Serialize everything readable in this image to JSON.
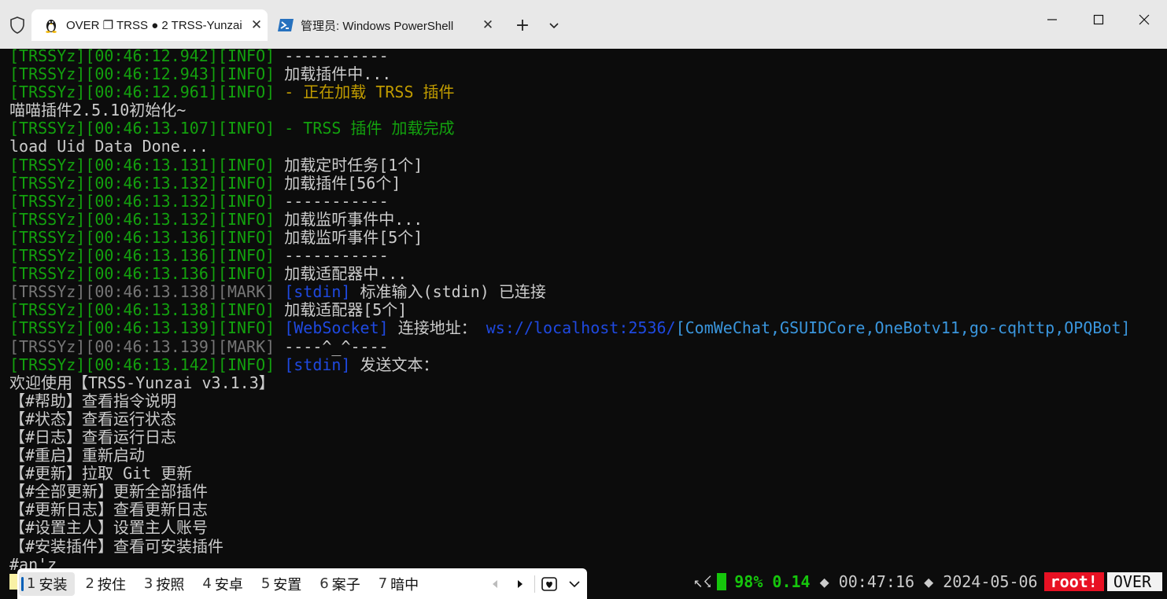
{
  "tabs": {
    "active_title": "OVER ❐ TRSS ● 2 TRSS-Yunzai",
    "inactive_title": "管理员: Windows PowerShell",
    "close_glyph": "✕",
    "new_tab_glyph": "+"
  },
  "terminal": {
    "lines": [
      [
        {
          "t": "[TRSSYz][00:46:12.942][INFO] ",
          "c": "green"
        },
        {
          "t": "-----------",
          "c": "white"
        }
      ],
      [
        {
          "t": "[TRSSYz][00:46:12.943][INFO] ",
          "c": "green"
        },
        {
          "t": "加载插件中...",
          "c": "white"
        }
      ],
      [
        {
          "t": "[TRSSYz][00:46:12.961][INFO] ",
          "c": "green"
        },
        {
          "t": "- 正在加载 TRSS 插件",
          "c": "gold"
        }
      ],
      [
        {
          "t": "喵喵插件2.5.10初始化~",
          "c": "white"
        }
      ],
      [
        {
          "t": "[TRSSYz][00:46:13.107][INFO] ",
          "c": "green"
        },
        {
          "t": "- TRSS 插件 加载完成",
          "c": "green"
        }
      ],
      [
        {
          "t": "load Uid Data Done...",
          "c": "white"
        }
      ],
      [
        {
          "t": "[TRSSYz][00:46:13.131][INFO] ",
          "c": "green"
        },
        {
          "t": "加载定时任务[1个]",
          "c": "white"
        }
      ],
      [
        {
          "t": "[TRSSYz][00:46:13.132][INFO] ",
          "c": "green"
        },
        {
          "t": "加载插件[56个]",
          "c": "white"
        }
      ],
      [
        {
          "t": "[TRSSYz][00:46:13.132][INFO] ",
          "c": "green"
        },
        {
          "t": "-----------",
          "c": "white"
        }
      ],
      [
        {
          "t": "[TRSSYz][00:46:13.132][INFO] ",
          "c": "green"
        },
        {
          "t": "加载监听事件中...",
          "c": "white"
        }
      ],
      [
        {
          "t": "[TRSSYz][00:46:13.136][INFO] ",
          "c": "green"
        },
        {
          "t": "加载监听事件[5个]",
          "c": "white"
        }
      ],
      [
        {
          "t": "[TRSSYz][00:46:13.136][INFO] ",
          "c": "green"
        },
        {
          "t": "-----------",
          "c": "white"
        }
      ],
      [
        {
          "t": "[TRSSYz][00:46:13.136][INFO] ",
          "c": "green"
        },
        {
          "t": "加载适配器中...",
          "c": "white"
        }
      ],
      [
        {
          "t": "[TRSSYz][00:46:13.138][MARK] ",
          "c": "gray"
        },
        {
          "t": "[stdin]",
          "c": "blue"
        },
        {
          "t": " 标准输入(stdin) 已连接",
          "c": "white"
        }
      ],
      [
        {
          "t": "[TRSSYz][00:46:13.138][INFO] ",
          "c": "green"
        },
        {
          "t": "加载适配器[5个]",
          "c": "white"
        }
      ],
      [
        {
          "t": "[TRSSYz][00:46:13.139][INFO] ",
          "c": "green"
        },
        {
          "t": "[WebSocket]",
          "c": "blue"
        },
        {
          "t": " 连接地址： ",
          "c": "white"
        },
        {
          "t": "ws://localhost:2536/",
          "c": "blue"
        },
        {
          "t": "[ComWeChat,GSUIDCore,OneBotv11,go-cqhttp,OPQBot]",
          "c": "cyan"
        }
      ],
      [
        {
          "t": "[TRSSYz][00:46:13.139][MARK] ",
          "c": "gray"
        },
        {
          "t": "----^_^----",
          "c": "white"
        }
      ],
      [
        {
          "t": "[TRSSYz][00:46:13.142][INFO] ",
          "c": "green"
        },
        {
          "t": "[stdin]",
          "c": "blue"
        },
        {
          "t": " 发送文本：",
          "c": "white"
        }
      ],
      [
        {
          "t": "欢迎使用【TRSS-Yunzai v3.1.3】",
          "c": "white"
        }
      ],
      [
        {
          "t": "【#帮助】查看指令说明",
          "c": "white"
        }
      ],
      [
        {
          "t": "【#状态】查看运行状态",
          "c": "white"
        }
      ],
      [
        {
          "t": "【#日志】查看运行日志",
          "c": "white"
        }
      ],
      [
        {
          "t": "【#重启】重新启动",
          "c": "white"
        }
      ],
      [
        {
          "t": "【#更新】拉取 Git 更新",
          "c": "white"
        }
      ],
      [
        {
          "t": "【#全部更新】更新全部插件",
          "c": "white"
        }
      ],
      [
        {
          "t": "【#更新日志】查看更新日志",
          "c": "white"
        }
      ],
      [
        {
          "t": "【#设置主人】设置主人账号",
          "c": "white"
        }
      ],
      [
        {
          "t": "【#安装插件】查看可安装插件",
          "c": "white"
        }
      ],
      [
        {
          "t": "#an'z",
          "c": "white"
        }
      ]
    ]
  },
  "status_bar": {
    "arrows": "↖☇",
    "battery": "98%",
    "load": "0.14",
    "sep": "◆",
    "time": "00:47:16",
    "date": "2024-05-06",
    "user": "root!",
    "mode": "OVER"
  },
  "ime": {
    "candidates": [
      {
        "num": "1",
        "text": "安装"
      },
      {
        "num": "2",
        "text": "按住"
      },
      {
        "num": "3",
        "text": "按照"
      },
      {
        "num": "4",
        "text": "安卓"
      },
      {
        "num": "5",
        "text": "安置"
      },
      {
        "num": "6",
        "text": "案子"
      },
      {
        "num": "7",
        "text": "暗中"
      }
    ]
  },
  "colors": {
    "green": "#13a10e",
    "gray": "#767676",
    "gold": "#c19c00",
    "blue": "#1f49e0",
    "cyan": "#3a96dd",
    "white": "#cccccc"
  }
}
